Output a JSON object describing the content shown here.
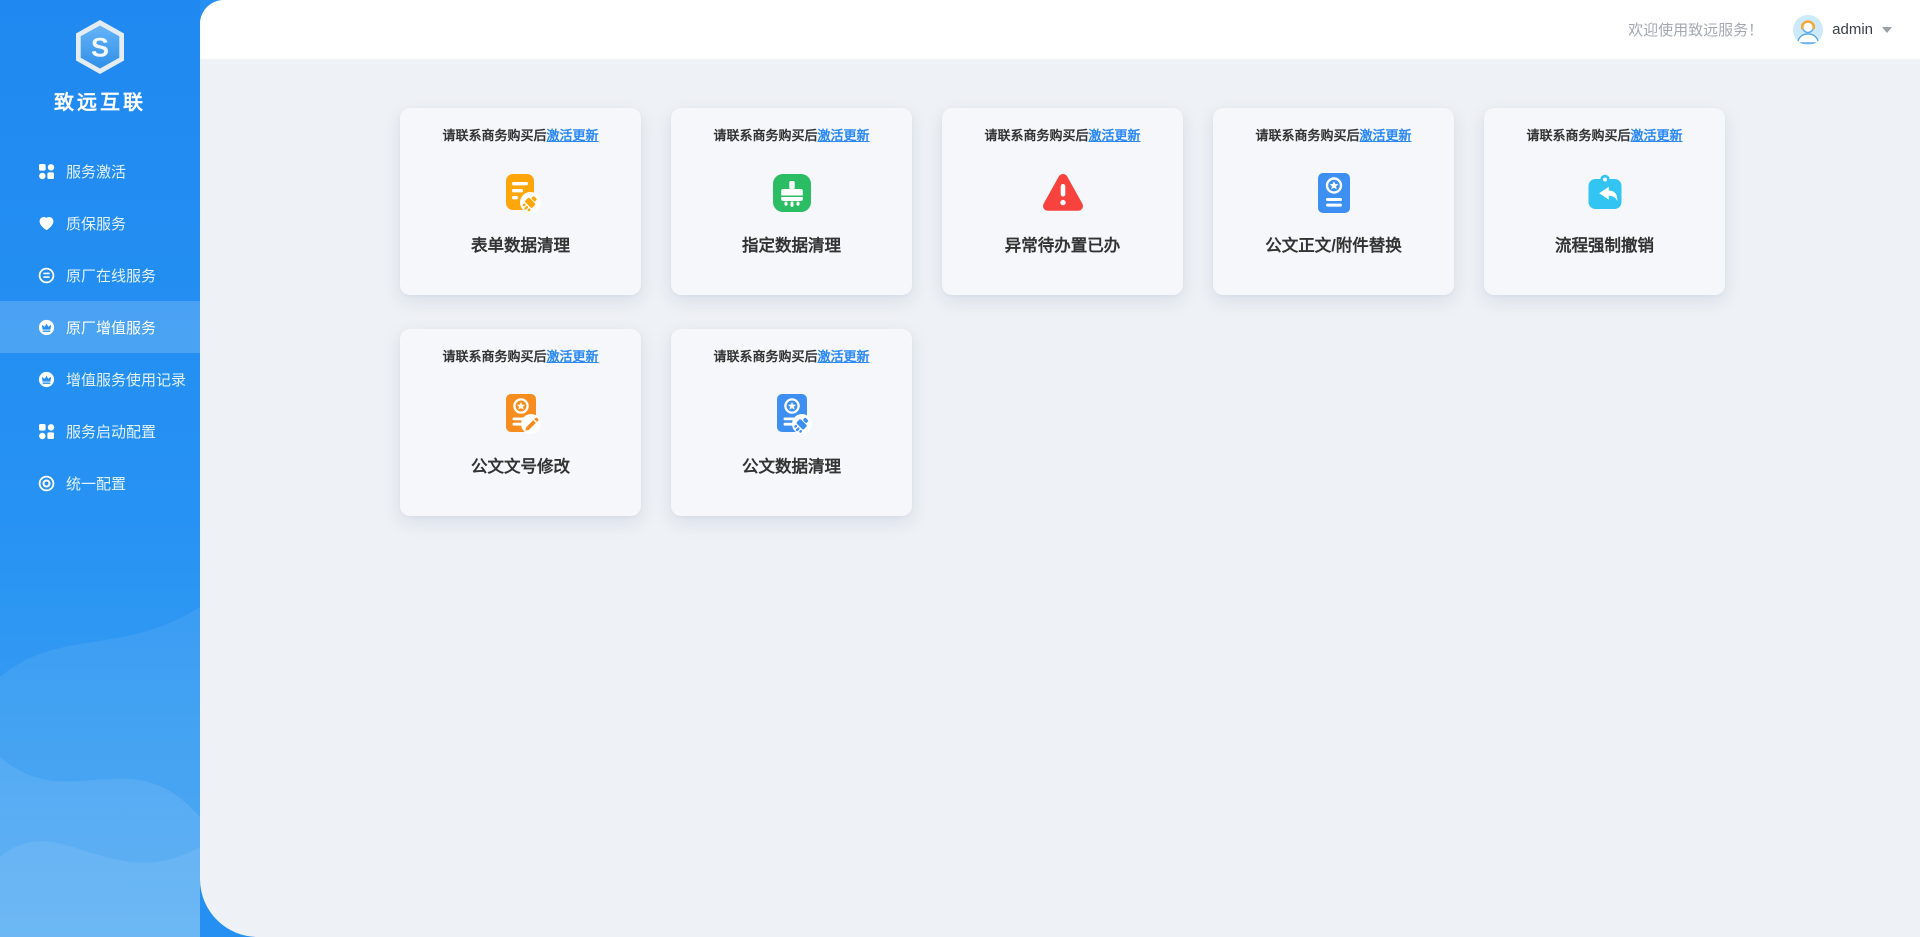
{
  "brand": {
    "name": "致远互联",
    "logo_letter": "S",
    "logo_icon": "hexagon-s-logo"
  },
  "colors": {
    "sidebar_blue": "#2590f2",
    "link_blue": "#2b88f5",
    "page_bg": "#eef1f5",
    "card_bg": "#f5f7fa"
  },
  "sidebar": {
    "items": [
      {
        "label": "服务激活",
        "icon": "grid-icon",
        "active": false
      },
      {
        "label": "质保服务",
        "icon": "heart-icon",
        "active": false
      },
      {
        "label": "原厂在线服务",
        "icon": "doc-circle-icon",
        "active": false
      },
      {
        "label": "原厂增值服务",
        "icon": "crown-icon",
        "active": true
      },
      {
        "label": "增值服务使用记录",
        "icon": "crown-icon",
        "active": false
      },
      {
        "label": "服务启动配置",
        "icon": "grid-icon",
        "active": false
      },
      {
        "label": "统一配置",
        "icon": "target-icon",
        "active": false
      }
    ]
  },
  "header": {
    "welcome": "欢迎使用致远服务！",
    "username": "admin",
    "avatar_icon": "support-agent-avatar"
  },
  "cards": [
    {
      "notice": "请联系商务购买后",
      "link": "激活更新",
      "title": "表单数据清理",
      "icon": "form-clean-icon",
      "color": "#ffa60b"
    },
    {
      "notice": "请联系商务购买后",
      "link": "激活更新",
      "title": "指定数据清理",
      "icon": "brush-clean-icon",
      "color": "#2abd63"
    },
    {
      "notice": "请联系商务购买后",
      "link": "激活更新",
      "title": "异常待办置已办",
      "icon": "warning-triangle-icon",
      "color": "#f8423e"
    },
    {
      "notice": "请联系商务购买后",
      "link": "激活更新",
      "title": "公文正文/附件替换",
      "icon": "doc-seal-icon",
      "color": "#3d8ff2"
    },
    {
      "notice": "请联系商务购买后",
      "link": "激活更新",
      "title": "流程强制撤销",
      "icon": "clipboard-undo-icon",
      "color": "#32c5f3"
    },
    {
      "notice": "请联系商务购买后",
      "link": "激活更新",
      "title": "公文文号修改",
      "icon": "doc-seal-edit-icon",
      "color": "#f78d1e"
    },
    {
      "notice": "请联系商务购买后",
      "link": "激活更新",
      "title": "公文数据清理",
      "icon": "doc-seal-clean-icon",
      "color": "#3d8ff2"
    }
  ]
}
